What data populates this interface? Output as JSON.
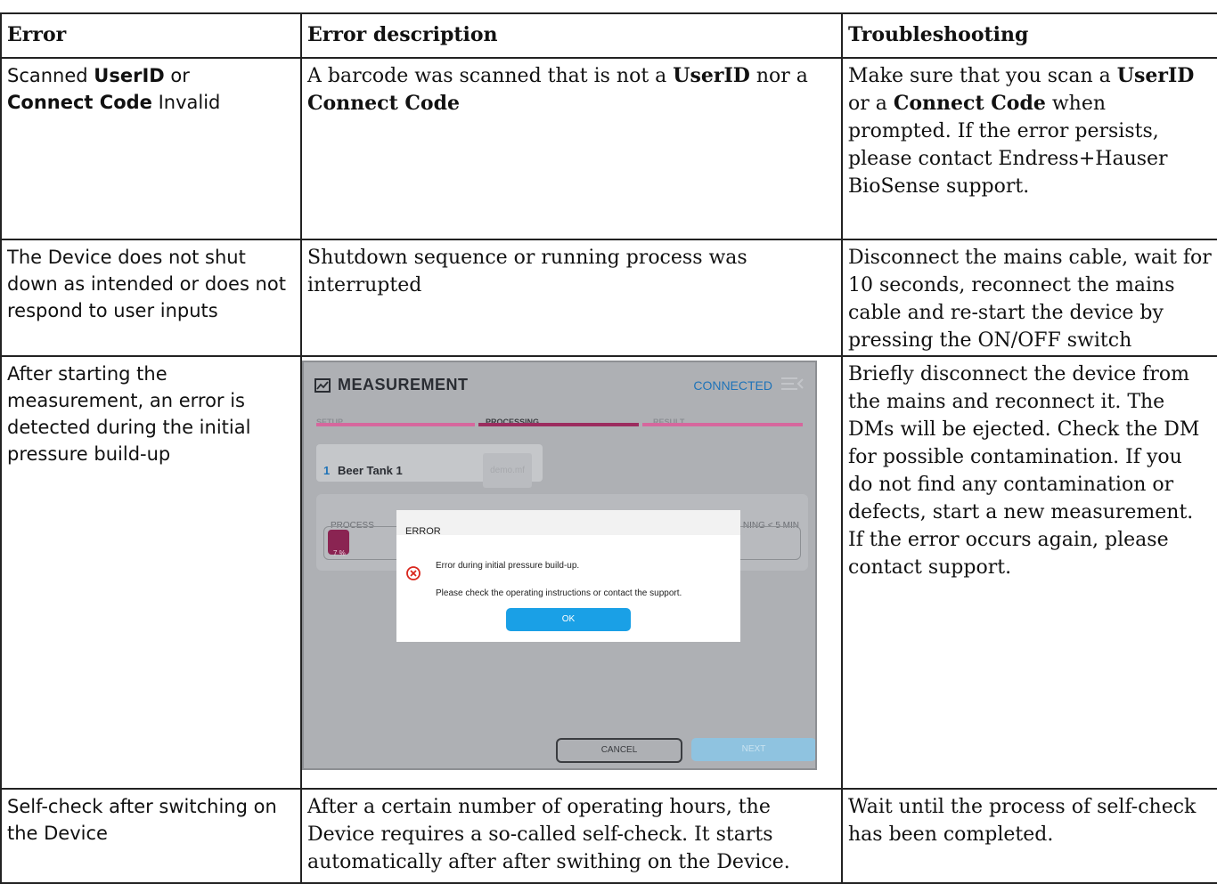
{
  "headers": {
    "error": "Error",
    "description": "Error description",
    "troubleshooting": "Troubleshooting"
  },
  "rows": [
    {
      "error_parts": [
        "Scanned ",
        "UserID",
        " or ",
        "Connect Code",
        " Invalid"
      ],
      "description_parts": [
        "A barcode was scanned that is not a ",
        "UserID",
        " nor a ",
        "Connect Code"
      ],
      "troubleshooting_parts": [
        "Make sure that you scan a ",
        "UserID",
        " or a ",
        "Connect Code",
        " when prompted. If the error persists, please contact Endress+Hauser BioSense support."
      ]
    },
    {
      "error": "The Device does not shut down as intended or does not respond to user inputs",
      "description": "Shutdown sequence or running process was interrupted",
      "troubleshooting": "Disconnect the mains cable, wait for 10 seconds, reconnect the mains cable and re-start the device by pressing the ON/OFF switch"
    },
    {
      "error": "After starting the measurement, an error is detected during the initial pressure build-up",
      "troubleshooting": "Briefly disconnect the device from the mains and reconnect it. The DMs will be ejected. Check the DM for possible contamination. If you do not find any contamination or defects, start a new measurement. If the error occurs again, please contact support."
    },
    {
      "error": "Self-check after switching on the Device",
      "description": "After a certain number of operating hours, the Device requires a so-called self-check. It starts automatically after after swithing on the Device.",
      "troubleshooting": "Wait until the process of self-check has been completed."
    }
  ],
  "screenshot": {
    "title": "MEASUREMENT",
    "title_icon": "chart-icon",
    "status": "CONNECTED",
    "menu_icon": "menu-icon",
    "steps": [
      "SETUP",
      "PROCESSING",
      "RESULT"
    ],
    "active_step": "PROCESSING",
    "job": {
      "number": "1",
      "name": "Beer Tank 1",
      "file": "demo.mf"
    },
    "process": {
      "label": "PROCESS",
      "remaining": "NING < 5 MIN",
      "percent_label": "7 %",
      "progress": 0.07
    },
    "dialog": {
      "title": "ERROR",
      "icon": "error-circle-icon",
      "line1": "Error during initial pressure build-up.",
      "line2": "Please check the operating instructions or contact the support.",
      "ok": "OK"
    },
    "buttons": {
      "cancel": "CANCEL",
      "next": "NEXT"
    },
    "colors": {
      "accent": "#1aa0e6",
      "brand": "#9c2c5f",
      "status": "#1f73b8",
      "error": "#d9261c"
    }
  }
}
